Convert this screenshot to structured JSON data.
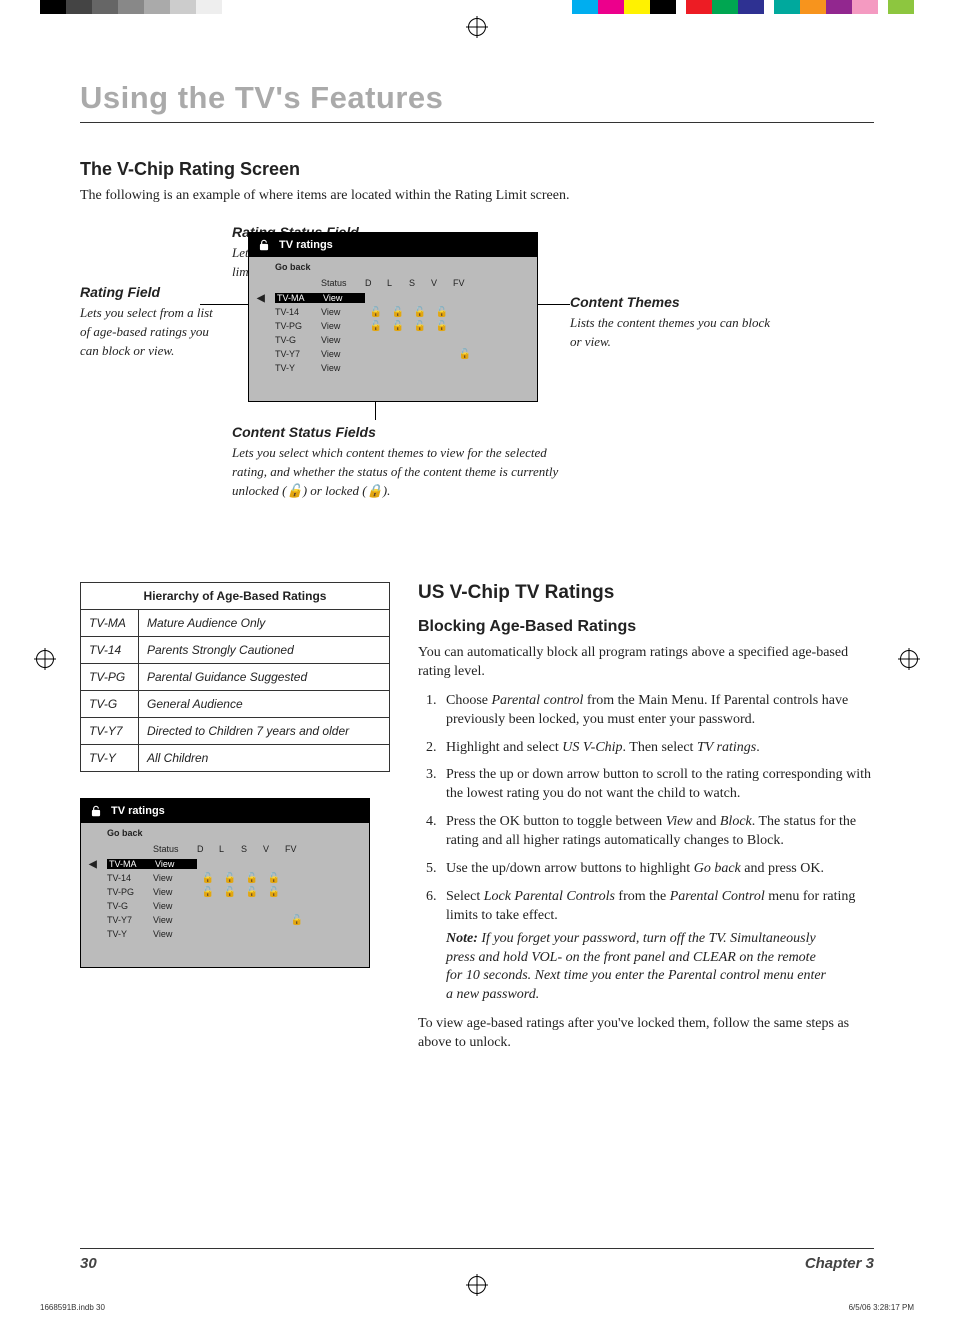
{
  "page_title": "Using the TV's Features",
  "section1_title": "The V-Chip Rating Screen",
  "section1_intro": "The following is an example of where items are located within the Rating Limit screen.",
  "callouts": {
    "rating_status_field": {
      "title": "Rating Status Field",
      "body": "Lets you select whether the status of the age-based rating limit to the left is View or Block."
    },
    "rating_field": {
      "title": "Rating Field",
      "body": "Lets you select from a list of age-based ratings you can block or view."
    },
    "content_themes": {
      "title": "Content Themes",
      "body": "Lists the content themes you can block or view."
    },
    "content_status_fields": {
      "title": "Content Status Fields",
      "body_pre": "Lets you select which content themes to view for the selected rating, and whether the status of the content theme is currently unlocked (",
      "body_mid": ") or locked (",
      "body_post": ")."
    }
  },
  "tv_screen": {
    "title": "TV ratings",
    "go_back": "Go back",
    "columns": {
      "status": "Status",
      "d": "D",
      "l": "L",
      "s": "S",
      "v": "V",
      "fv": "FV"
    },
    "rows": [
      {
        "rating": "TV-MA",
        "status": "View",
        "highlight": true,
        "locks": [
          false,
          false,
          false,
          false,
          false
        ]
      },
      {
        "rating": "TV-14",
        "status": "View",
        "highlight": false,
        "locks": [
          true,
          true,
          true,
          true,
          false
        ]
      },
      {
        "rating": "TV-PG",
        "status": "View",
        "highlight": false,
        "locks": [
          true,
          true,
          true,
          true,
          false
        ]
      },
      {
        "rating": "TV-G",
        "status": "View",
        "highlight": false,
        "locks": [
          false,
          false,
          false,
          false,
          false
        ]
      },
      {
        "rating": "TV-Y7",
        "status": "View",
        "highlight": false,
        "locks": [
          false,
          false,
          false,
          false,
          true
        ]
      },
      {
        "rating": "TV-Y",
        "status": "View",
        "highlight": false,
        "locks": [
          false,
          false,
          false,
          false,
          false
        ]
      }
    ]
  },
  "hierarchy_table": {
    "title": "Hierarchy of Age-Based Ratings",
    "rows": [
      {
        "code": "TV-MA",
        "desc": "Mature Audience Only"
      },
      {
        "code": "TV-14",
        "desc": "Parents Strongly Cautioned"
      },
      {
        "code": "TV-PG",
        "desc": "Parental Guidance Suggested"
      },
      {
        "code": "TV-G",
        "desc": "General Audience"
      },
      {
        "code": "TV-Y7",
        "desc": "Directed to Children 7 years and older"
      },
      {
        "code": "TV-Y",
        "desc": "All Children"
      }
    ]
  },
  "section2_title": "US V-Chip TV Ratings",
  "section2_sub": "Blocking Age-Based Ratings",
  "section2_intro": "You can automatically block all program ratings above a specified age-based rating level.",
  "steps": [
    {
      "pre": "Choose ",
      "em1": "Parental control",
      "mid": " from the Main Menu. If Parental controls have previously been locked, you must enter your password."
    },
    {
      "pre": "Highlight and select ",
      "em1": "US V-Chip",
      "mid": ". Then select ",
      "em2": "TV ratings",
      "post": "."
    },
    {
      "pre": "Press the up or down arrow button to scroll to the rating corresponding with the lowest rating you do not want the child to watch."
    },
    {
      "pre": "Press the OK button to toggle between ",
      "em1": "View",
      "mid": " and ",
      "em2": "Block",
      "post": ". The status for the rating and all higher ratings automatically changes to Block."
    },
    {
      "pre": "Use the up/down arrow buttons to highlight ",
      "em1": "Go back",
      "mid": " and press OK."
    },
    {
      "pre": "Select ",
      "em1": "Lock Parental Controls",
      "mid": " from the ",
      "em2": "Parental Control",
      "post": " menu for rating limits to take effect."
    }
  ],
  "note_label": "Note:",
  "note_body": " If you forget your password, turn off the TV. Simultaneously press and hold VOL- on the front panel and CLEAR on the remote for 10 seconds. Next time you enter the Parental control menu enter a new password.",
  "closing": "To view age-based ratings after you've locked them, follow the same steps as above to unlock.",
  "footer": {
    "page_no": "30",
    "chapter": "Chapter 3"
  },
  "printmeta": {
    "file": "1668591B.indb   30",
    "datetime": "6/5/06   3:28:17 PM"
  },
  "icons": {
    "lock": "lock-icon",
    "unlock": "unlock-icon"
  }
}
